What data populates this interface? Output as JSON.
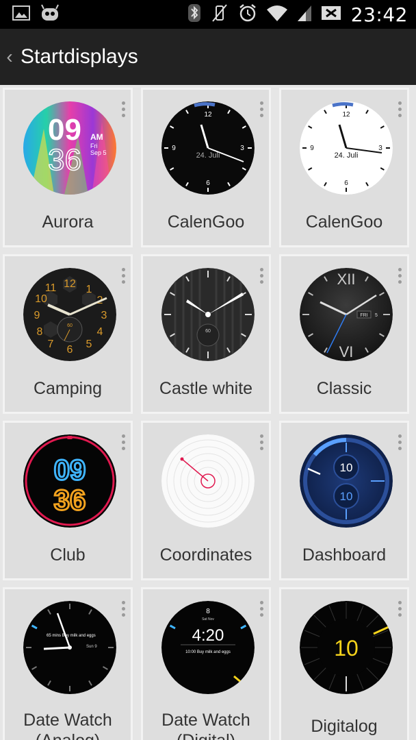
{
  "status_bar": {
    "time": "23:42",
    "left_icons": [
      "image-icon",
      "cyanogen-mascot-icon"
    ],
    "right_icons": [
      "bluetooth-icon",
      "vibrate-off-icon",
      "alarm-icon",
      "wifi-icon",
      "signal-icon",
      "battery-icon"
    ]
  },
  "action_bar": {
    "back_glyph": "‹",
    "title": "Startdisplays"
  },
  "watchfaces": [
    {
      "label": "Aurora",
      "face": "aurora",
      "digits_hour": "09",
      "digits_min": "36",
      "ampm": "AM",
      "day": "Fri",
      "date": "Sep 5"
    },
    {
      "label": "CalenGoo",
      "face": "calengoo-dark",
      "date": "24. Juli",
      "n12": "12",
      "n3": "3",
      "n6": "6",
      "n9": "9"
    },
    {
      "label": "CalenGoo",
      "face": "calengoo-light",
      "date": "24. Juli",
      "n12": "12",
      "n3": "3",
      "n6": "6",
      "n9": "9"
    },
    {
      "label": "Camping",
      "face": "camping",
      "sub": "60"
    },
    {
      "label": "Castle white",
      "face": "castle",
      "sub": "60"
    },
    {
      "label": "Classic",
      "face": "classic",
      "day": "FRI",
      "date": "5"
    },
    {
      "label": "Club",
      "face": "club",
      "digits_hour": "09",
      "digits_min": "36"
    },
    {
      "label": "Coordinates",
      "face": "coordinates"
    },
    {
      "label": "Dashboard",
      "face": "dashboard",
      "top": "10",
      "bottom": "10"
    },
    {
      "label": "Date Watch\n(Analog)",
      "face": "datewatch-analog",
      "line1": "65 mins Buy milk and eggs",
      "line2": "Sun 9"
    },
    {
      "label": "Date Watch\n(Digital)",
      "face": "datewatch-digital",
      "date": "8",
      "day": "Sat Nov",
      "time": "4:20",
      "line": "10:00 Buy milk and eggs"
    },
    {
      "label": "Digitalog",
      "face": "digitalog",
      "value": "10"
    }
  ],
  "colors": {
    "status_bar": "#000000",
    "action_bar": "#222222",
    "background": "#e6e6e6",
    "card": "#dedede",
    "club_ring": "#e0194f",
    "dashboard_blue": "#1e3a78",
    "digitalog_yellow": "#f5d31b"
  }
}
